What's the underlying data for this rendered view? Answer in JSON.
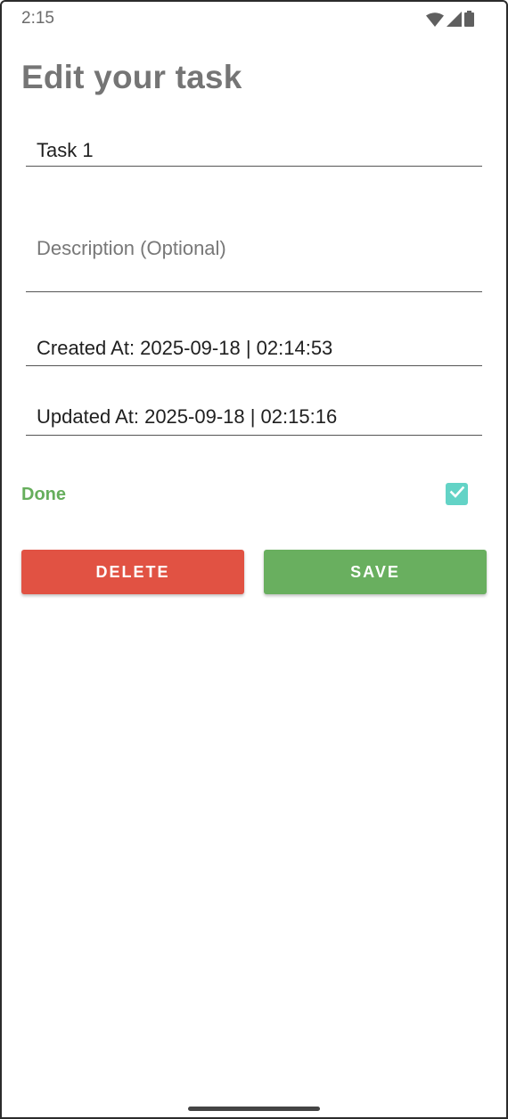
{
  "status_bar": {
    "time": "2:15",
    "icons": [
      "wifi-icon",
      "cellular-signal-icon",
      "battery-icon"
    ]
  },
  "page": {
    "title": "Edit your task"
  },
  "form": {
    "title_value": "Task 1",
    "description_placeholder": "Description (Optional)",
    "description_value": "",
    "created_at": "Created At: 2025-09-18 | 02:14:53",
    "updated_at": "Updated At: 2025-09-18 | 02:15:16",
    "done_label": "Done",
    "done_checked": true
  },
  "actions": {
    "delete_label": "DELETE",
    "save_label": "SAVE"
  },
  "colors": {
    "title": "#757575",
    "done_label": "#66ae5c",
    "checkbox": "#63d3c6",
    "delete": "#e15243",
    "save": "#69af5f"
  }
}
